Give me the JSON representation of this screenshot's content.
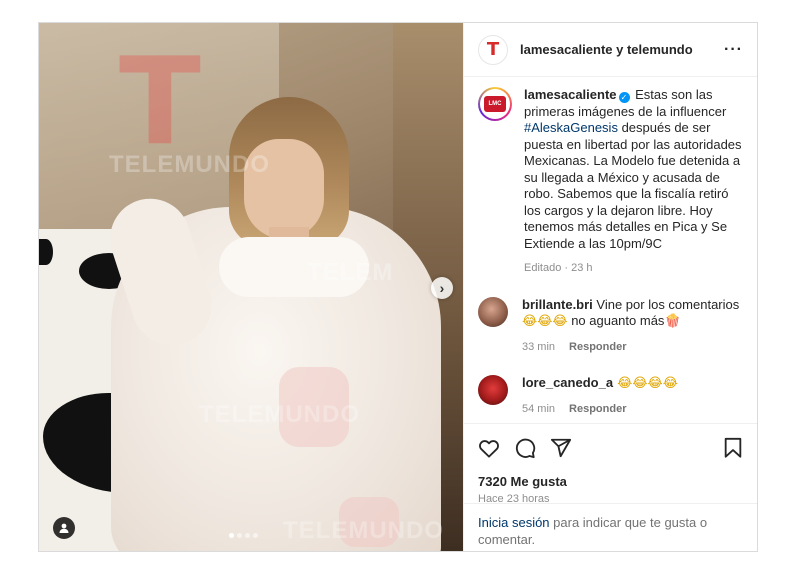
{
  "header": {
    "names": "lamesacaliente y telemundo",
    "more": "···"
  },
  "media": {
    "watermarks": [
      "TELEMUNDO",
      "TELEMUNDO",
      "TELEMUNDO",
      "TELEM"
    ],
    "slide_index": 1,
    "slide_count": 4
  },
  "caption": {
    "user": "lamesacaliente",
    "text_before": " Estas son las primeras imágenes de la influencer ",
    "hashtag": "#AleskaGenesis",
    "text_after": " después de ser puesta en libertad por las autoridades Mexicanas. La Modelo fue detenida a su llegada a México y acusada de robo. Sabemos que la fiscalía retiró los cargos y la dejaron libre. Hoy tenemos más detalles en Pica y Se Extiende a las 10pm/9C",
    "meta": "Editado · 23 h"
  },
  "comments": [
    {
      "user": "brillante.bri",
      "text": " Vine por los comentarios ",
      "emojis": "😂😂😂",
      "text2": " no aguanto más",
      "emoji2": "🍿",
      "time": "33 min",
      "reply": "Responder"
    },
    {
      "user": "lore_canedo_a",
      "emojis": " 😂😂😂😂",
      "time": "54 min",
      "reply": "Responder"
    }
  ],
  "stats": {
    "likes": "7320 Me gusta",
    "time": "Hace 23 horas"
  },
  "footer": {
    "login": "Inicia sesión",
    "rest": " para indicar que te gusta o comentar."
  },
  "colors": {
    "link": "#00376b",
    "verified": "#0095f6",
    "telemundo_red": "#d62c2c"
  },
  "icons": [
    "heart-icon",
    "comment-icon",
    "share-icon",
    "bookmark-icon",
    "chevron-right-icon",
    "user-tag-icon",
    "more-icon",
    "verified-icon"
  ]
}
